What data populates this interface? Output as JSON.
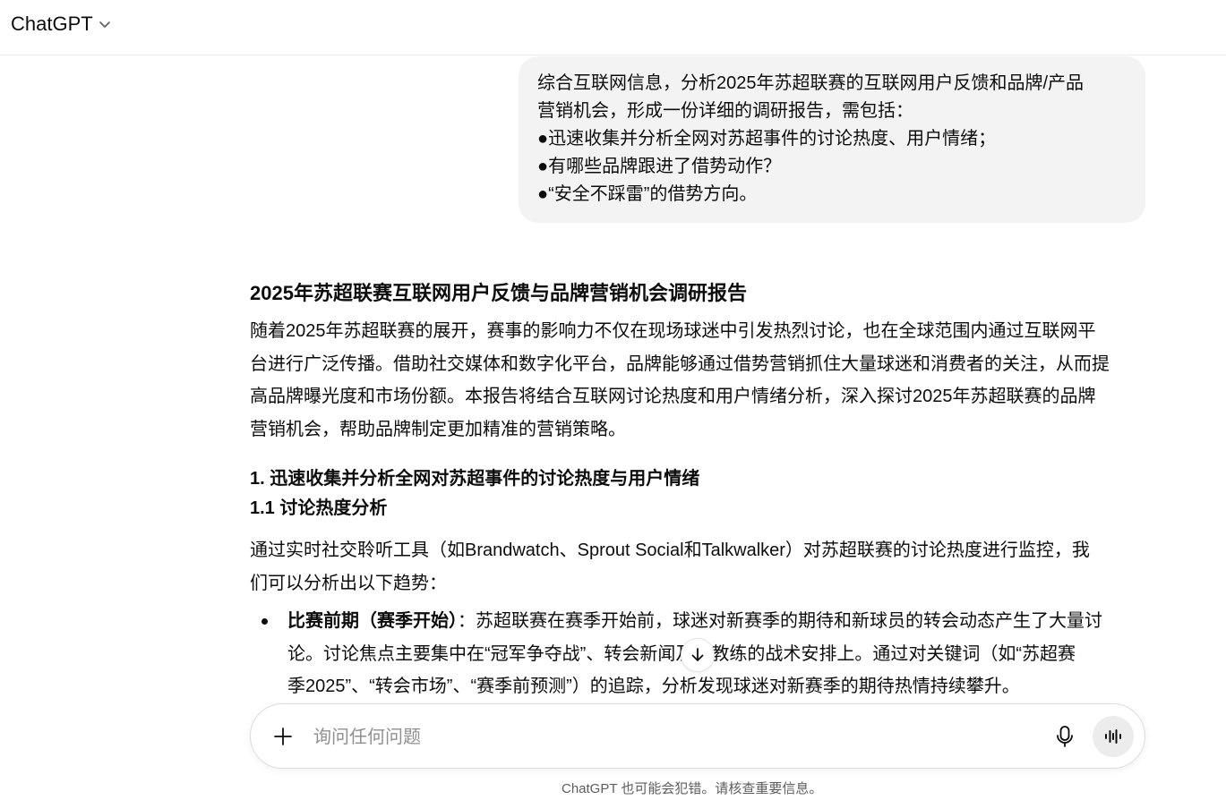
{
  "header": {
    "model_name": "ChatGPT",
    "switcher_icon": "chevron-down-icon"
  },
  "user_message": {
    "lines": [
      "综合互联网信息，分析2025年苏超联赛的互联网用户反馈和品牌/产品",
      "营销机会，形成一份详细的调研报告，需包括：",
      "●迅速收集并分析全网对苏超事件的讨论热度、用户情绪；",
      "●有哪些品牌跟进了借势动作？",
      "●“安全不踩雷”的借势方向。"
    ]
  },
  "assistant_message": {
    "title": "2025年苏超联赛互联网用户反馈与品牌营销机会调研报告",
    "intro_lines": [
      "随着2025年苏超联赛的展开，赛事的影响力不仅在现场球迷中引发热烈讨论，也在全球范围内通过互联网平",
      "台进行广泛传播。借助社交媒体和数字化平台，品牌能够通过借势营销抓住大量球迷和消费者的关注，从而提",
      "高品牌曝光度和市场份额。本报告将结合互联网讨论热度和用户情绪分析，深入探讨2025年苏超联赛的品牌",
      "营销机会，帮助品牌制定更加精准的营销策略。"
    ],
    "section_1_heading": "1. 迅速收集并分析全网对苏超事件的讨论热度与用户情绪",
    "section_1_1_heading": "1.1 讨论热度分析",
    "section_1_1_lines": [
      "通过实时社交聆听工具（如Brandwatch、Sprout Social和Talkwalker）对苏超联赛的讨论热度进行监控，我",
      "们可以分析出以下趋势："
    ],
    "bullet_1": {
      "label": "比赛前期（赛季开始）",
      "line_1_rest": "：苏超联赛在赛季开始前，球迷对新赛季的期待和新球员的转会动态产生了大量讨",
      "line_2": "论。讨论焦点主要集中在“冠军争夺战”、转会新闻及新教练的战术安排上。通过对关键词（如“苏超赛",
      "line_3": "季2025”、“转会市场”、“赛季前预测”）的追踪，分析发现球迷对新赛季的期待热情持续攀升。"
    }
  },
  "composer": {
    "placeholder": "询问任何问题",
    "add_icon": "plus-icon",
    "mic_icon": "microphone-icon",
    "voice_icon": "voice-mode-icon"
  },
  "scroll_down_icon": "arrow-down-icon",
  "disclaimer": "ChatGPT 也可能会犯错。请核查重要信息。"
}
